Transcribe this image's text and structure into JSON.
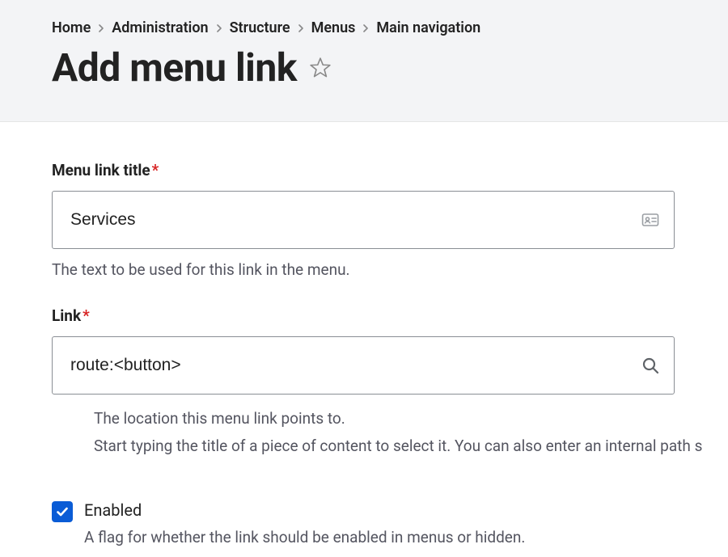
{
  "breadcrumb": {
    "items": [
      {
        "label": "Home"
      },
      {
        "label": "Administration"
      },
      {
        "label": "Structure"
      },
      {
        "label": "Menus"
      },
      {
        "label": "Main navigation"
      }
    ]
  },
  "page": {
    "title": "Add menu link"
  },
  "form": {
    "menu_link_title": {
      "label": "Menu link title",
      "required": "*",
      "value": "Services",
      "description": "The text to be used for this link in the menu."
    },
    "link": {
      "label": "Link",
      "required": "*",
      "value": "route:<button>",
      "descriptions": [
        "The location this menu link points to.",
        "Start typing the title of a piece of content to select it. You can also enter an internal path s"
      ]
    },
    "enabled": {
      "label": "Enabled",
      "checked": true,
      "description": "A flag for whether the link should be enabled in menus or hidden."
    }
  },
  "colors": {
    "accent": "#0a5cd6",
    "required_marker": "#d72222"
  }
}
